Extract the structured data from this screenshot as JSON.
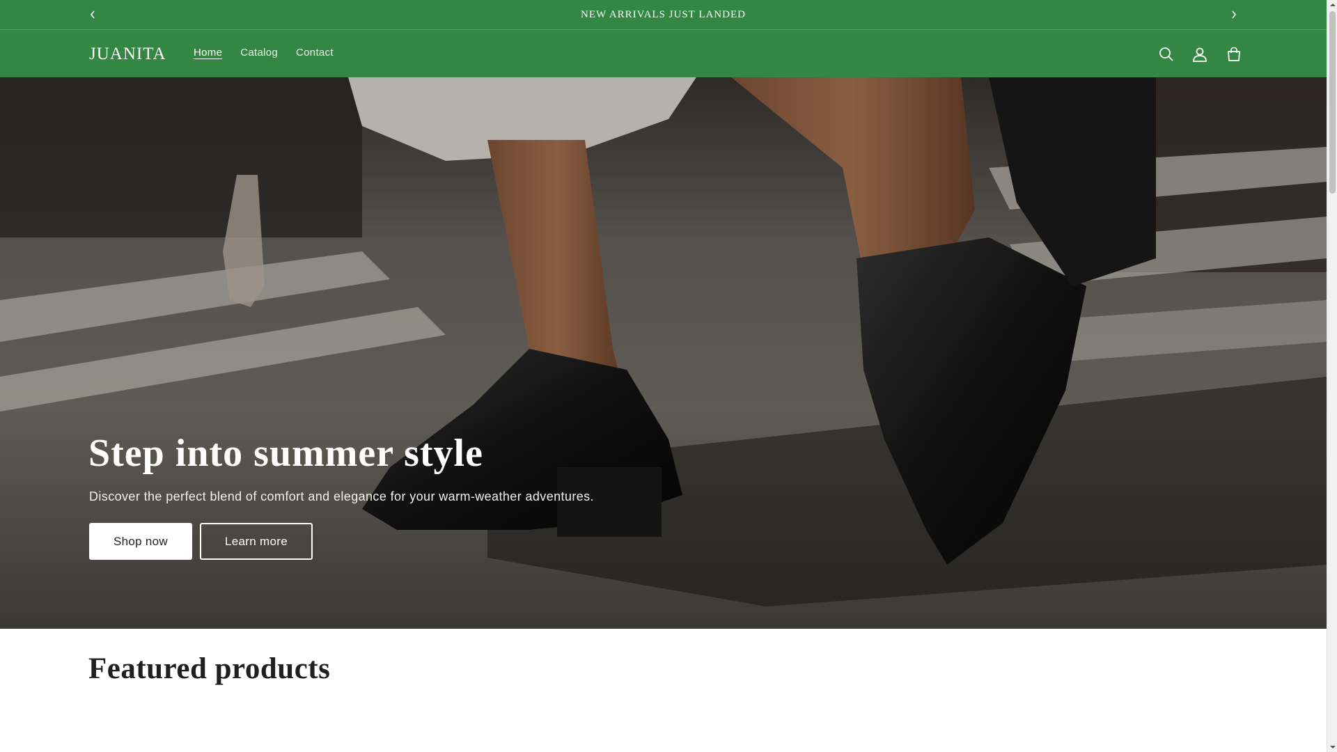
{
  "announcement": {
    "text": "NEW ARRIVALS JUST LANDED",
    "prev_icon": "chevron-left-icon",
    "next_icon": "chevron-right-icon"
  },
  "header": {
    "logo": "JUANITA",
    "nav": [
      {
        "label": "Home",
        "active": true
      },
      {
        "label": "Catalog",
        "active": false
      },
      {
        "label": "Contact",
        "active": false
      }
    ],
    "icons": [
      "search-icon",
      "account-icon",
      "cart-icon"
    ]
  },
  "hero": {
    "title": "Step into summer style",
    "subtitle": "Discover the perfect blend of comfort and elegance for your warm-weather adventures.",
    "primary_button": "Shop now",
    "secondary_button": "Learn more",
    "image": "woman-walking-in-black-loafers-street-photo"
  },
  "featured": {
    "title": "Featured products"
  },
  "colors": {
    "brand_green": "#338743",
    "white": "#ffffff",
    "text_dark": "#1f1f1f"
  }
}
